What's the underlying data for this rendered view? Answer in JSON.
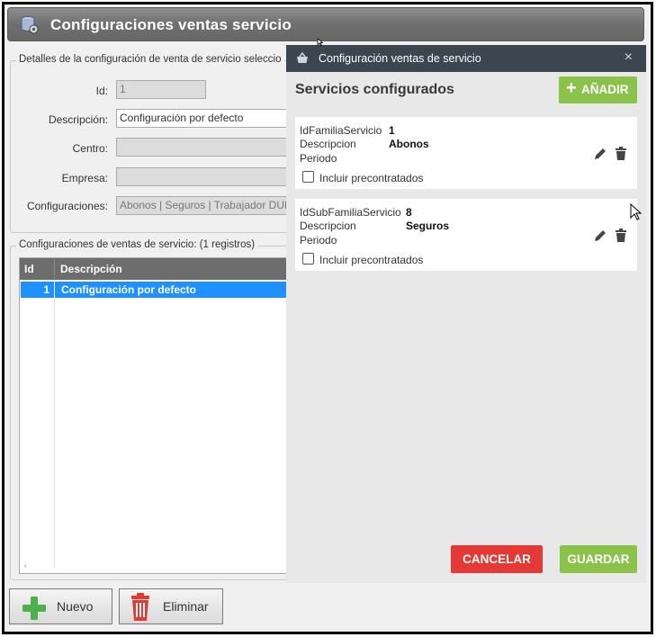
{
  "window": {
    "title": "Configuraciones ventas servicio",
    "icon": "database-gear-icon"
  },
  "details": {
    "legend": "Detalles de la configuración de venta de servicio seleccio",
    "id_label": "Id:",
    "id_value": "1",
    "descripcion_label": "Descripción:",
    "descripcion_value": "Configuración por defecto",
    "centro_label": "Centro:",
    "centro_value": "",
    "empresa_label": "Empresa:",
    "empresa_value": "",
    "configuraciones_label": "Configuraciones:",
    "configuraciones_value": "Abonos | Seguros | Trabajador DUE"
  },
  "list": {
    "legend": "Configuraciones de ventas de servicio:  (1 registros)",
    "columns": [
      "Id",
      "Descripción"
    ],
    "rows": [
      {
        "id": "1",
        "descripcion": "Configuración por defecto"
      }
    ],
    "scroll_glyph": "‹"
  },
  "toolbar": {
    "nuevo": "Nuevo",
    "eliminar": "Eliminar"
  },
  "dialog": {
    "title": "Configuración ventas de servicio",
    "close_glyph": "×",
    "subtitle": "Servicios configurados",
    "add_label": "AÑADIR",
    "add_glyph": "+",
    "cards": [
      {
        "key1": "IdFamiliaServicio",
        "val1": "1",
        "key2": "Descripcion",
        "val2": "Abonos",
        "key3": "Periodo",
        "checkbox_label": "Incluir precontratados"
      },
      {
        "key1": "IdSubFamiliaServicio",
        "val1": "8",
        "key2": "Descripcion",
        "val2": "Seguros",
        "key3": "Periodo",
        "checkbox_label": "Incluir precontratados"
      }
    ],
    "cancel_label": "CANCELAR",
    "save_label": "GUARDAR"
  },
  "colors": {
    "accent_green": "#8bc34a",
    "danger_red": "#e53935",
    "dialog_header": "#3b4650",
    "selection_blue": "#1e90ff"
  }
}
